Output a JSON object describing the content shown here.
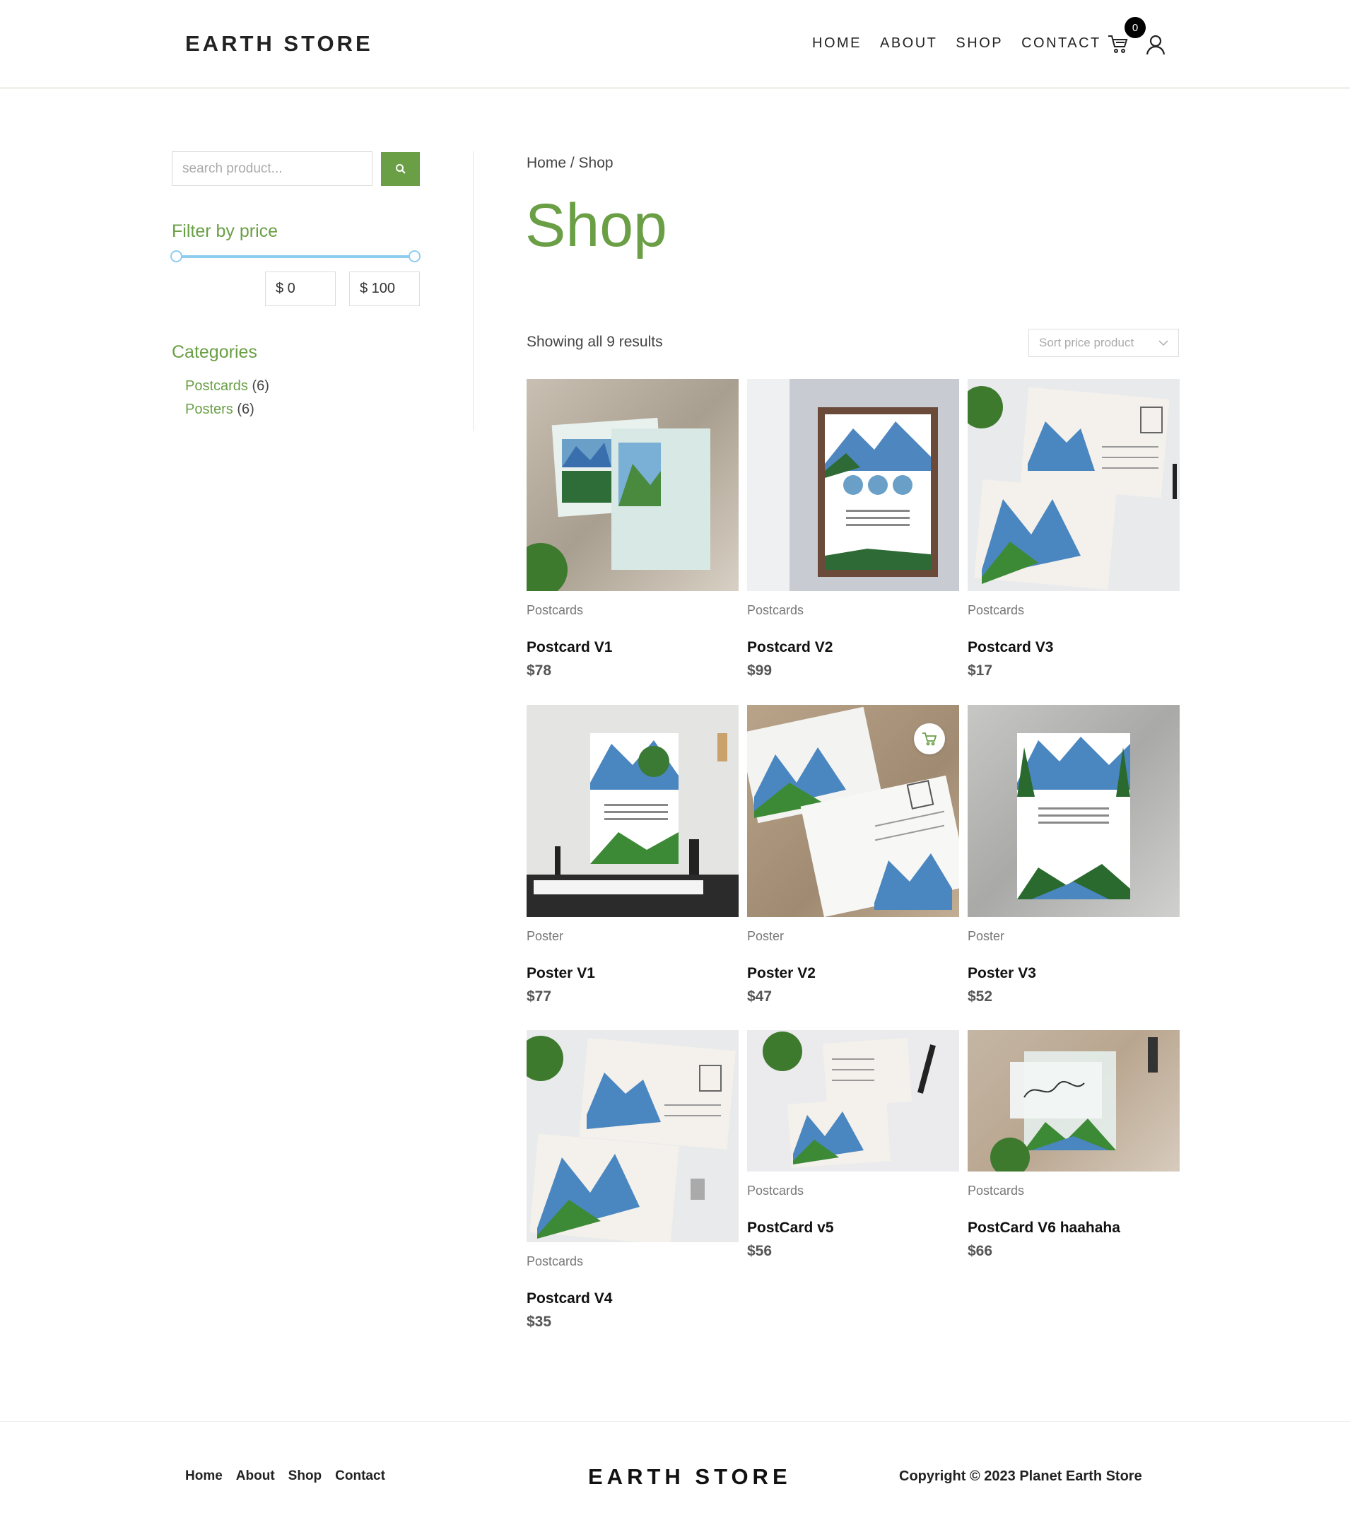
{
  "header": {
    "logo": "EARTH STORE",
    "nav": [
      "HOME",
      "ABOUT",
      "SHOP",
      "CONTACT"
    ],
    "cart_count": "0"
  },
  "sidebar": {
    "search_placeholder": "search product...",
    "filter_heading": "Filter by price",
    "price_min": "$ 0",
    "price_max": "$ 100",
    "categories_heading": "Categories",
    "categories": [
      {
        "name": "Postcards",
        "count": "(6)"
      },
      {
        "name": "Posters",
        "count": "(6)"
      }
    ]
  },
  "main": {
    "breadcrumb": "Home / Shop",
    "title": "Shop",
    "result_count": "Showing all 9 results",
    "sort_placeholder": "Sort price product"
  },
  "products": [
    {
      "category": "Postcards",
      "name": "Postcard V1",
      "price": "$78"
    },
    {
      "category": "Postcards",
      "name": "Postcard V2",
      "price": "$99"
    },
    {
      "category": "Postcards",
      "name": "Postcard V3",
      "price": "$17"
    },
    {
      "category": "Poster",
      "name": "Poster V1",
      "price": "$77"
    },
    {
      "category": "Poster",
      "name": "Poster V2",
      "price": "$47"
    },
    {
      "category": "Poster",
      "name": "Poster V3",
      "price": "$52"
    },
    {
      "category": "Postcards",
      "name": "Postcard V4",
      "price": "$35"
    },
    {
      "category": "Postcards",
      "name": "PostCard v5",
      "price": "$56"
    },
    {
      "category": "Postcards",
      "name": "PostCard V6 haahaha",
      "price": "$66"
    }
  ],
  "footer": {
    "links": [
      "Home",
      "About",
      "Shop",
      "Contact"
    ],
    "logo": "EARTH STORE",
    "copyright": "Copyright © 2023 Planet Earth Store"
  },
  "colors": {
    "accent": "#6a9f45",
    "slider": "#8ecdf0",
    "badge": "#000000"
  }
}
